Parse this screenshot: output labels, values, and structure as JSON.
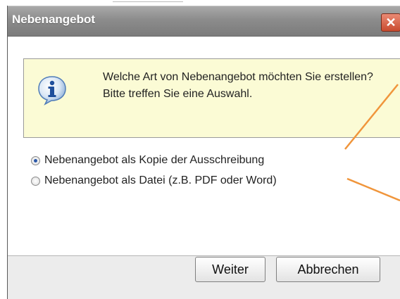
{
  "dialog": {
    "title": "Nebenangebot",
    "close_glyph": "✕",
    "info_icon": "info-icon",
    "message": "Welche Art von Nebenangebot möchten Sie erstellen? Bitte treffen Sie eine Auswahl."
  },
  "options": [
    {
      "label": "Nebenangebot als Kopie der Ausschreibung",
      "checked": true
    },
    {
      "label": "Nebenangebot als Datei (z.B. PDF oder Word)",
      "checked": false
    }
  ],
  "buttons": {
    "next": "Weiter",
    "cancel": "Abbrechen"
  },
  "colors": {
    "titlebar": "#8c8c8c",
    "close": "#c94b2f",
    "info_bg": "#fbfbd5",
    "annotation_line": "#f0953b"
  }
}
